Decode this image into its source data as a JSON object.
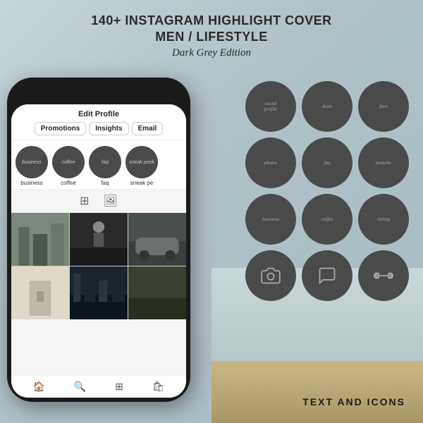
{
  "header": {
    "line1": "140+ INSTAGRAM HIGHLIGHT COVER",
    "line2": "MEN / LIFESTYLE",
    "subtitle": "Dark Grey Edition"
  },
  "phone": {
    "edit_profile_label": "Edit Profile",
    "buttons": [
      "Promotions",
      "Insights",
      "Email"
    ],
    "stories": [
      {
        "label": "business",
        "icon_text": "business"
      },
      {
        "label": "coffee",
        "icon_text": "coffee"
      },
      {
        "label": "faq",
        "icon_text": "faq"
      },
      {
        "label": "sneak pe",
        "icon_text": "sneak peek"
      }
    ],
    "bottom_icons": [
      "🏠",
      "🔍",
      "⊞",
      "🛍"
    ]
  },
  "circles_grid": {
    "rows": [
      [
        {
          "type": "text",
          "content": "social\nprofile"
        },
        {
          "type": "text",
          "content": "deals"
        },
        {
          "type": "text",
          "content": "fave"
        }
      ],
      [
        {
          "type": "text",
          "content": "photos"
        },
        {
          "type": "text",
          "content": "faq"
        },
        {
          "type": "text",
          "content": "youtube"
        }
      ],
      [
        {
          "type": "text",
          "content": "business"
        },
        {
          "type": "text",
          "content": "coffee"
        },
        {
          "type": "text",
          "content": "styling"
        }
      ],
      [
        {
          "type": "icon",
          "content": "camera"
        },
        {
          "type": "icon",
          "content": "message"
        },
        {
          "type": "icon",
          "content": "dumbbell"
        }
      ]
    ]
  },
  "footer": {
    "text": "TEXT AND ICONS"
  }
}
